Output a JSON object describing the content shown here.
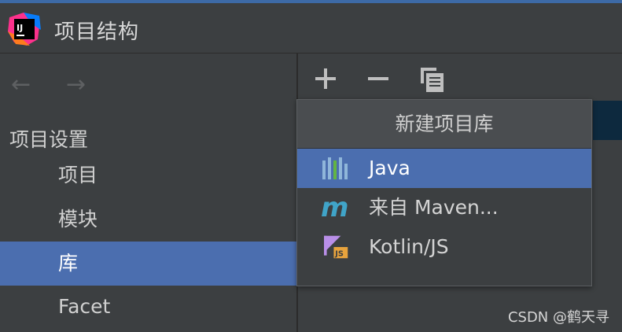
{
  "window": {
    "title": "项目结构",
    "logo_text": "IJ"
  },
  "nav": {
    "back_icon": "arrow-left-icon",
    "forward_icon": "arrow-right-icon"
  },
  "sidebar": {
    "section_label": "项目设置",
    "items": [
      {
        "label": "项目",
        "selected": false
      },
      {
        "label": "模块",
        "selected": false
      },
      {
        "label": "库",
        "selected": true
      },
      {
        "label": "Facet",
        "selected": false
      }
    ]
  },
  "toolbar": {
    "add_icon": "plus-icon",
    "remove_icon": "minus-icon",
    "copy_icon": "copy-icon"
  },
  "popup": {
    "title": "新建项目库",
    "items": [
      {
        "label": "Java",
        "icon": "java-library-icon",
        "selected": true
      },
      {
        "label": "来自 Maven...",
        "icon": "maven-icon",
        "selected": false
      },
      {
        "label": "Kotlin/JS",
        "icon": "kotlin-js-icon",
        "selected": false
      }
    ]
  },
  "watermark": "CSDN @鹤天寻",
  "colors": {
    "accent": "#4b6eaf",
    "background": "#3c3f41",
    "popup_header": "#4a4d50"
  }
}
